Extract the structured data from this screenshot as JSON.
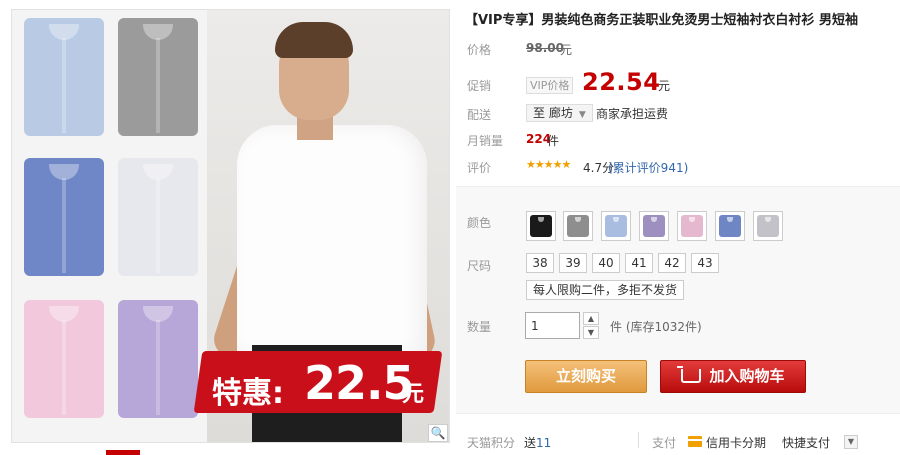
{
  "product": {
    "title": "【VIP专享】男装纯色商务正装职业免烫男士短袖衬衣白衬衫 男短袖"
  },
  "image": {
    "promo_label": "特惠:",
    "promo_price": "22.5",
    "promo_unit": "元",
    "thumbnail_colors": [
      "#b9cbe4",
      "#9b9b9b",
      "#6f87c6",
      "#e7e7ee",
      "#f1c8dc",
      "#b7a6d8"
    ]
  },
  "price": {
    "label": "价格",
    "original": "98.00",
    "original_unit": "元"
  },
  "promo": {
    "label": "促销",
    "tag": "VIP价格",
    "price": "22.54",
    "unit": "元"
  },
  "shipping": {
    "label": "配送",
    "destination": "至 廊坊",
    "note": "商家承担运费"
  },
  "sales": {
    "label": "月销量",
    "count": "224",
    "unit": "件"
  },
  "rating": {
    "label": "评价",
    "stars": "★★★★★",
    "score": "4.7分",
    "reviews": "(累计评价941)"
  },
  "sku": {
    "color_label": "颜色",
    "colors": [
      "#1a1a1a",
      "#8e8e8e",
      "#a9bde0",
      "#9d8fbf",
      "#e6b8cf",
      "#6f86c4",
      "#c2c2c8"
    ],
    "size_label": "尺码",
    "sizes": [
      "38",
      "39",
      "40",
      "41",
      "42",
      "43"
    ],
    "size_note": "每人限购二件，多拒不发货",
    "qty_label": "数量",
    "qty_value": "1",
    "qty_unit": "件 (库存1032件)"
  },
  "actions": {
    "buy_now": "立刻购买",
    "add_to_cart": "加入购物车"
  },
  "footer": {
    "points_label": "天猫积分",
    "points_prefix": "送",
    "points_value": "11",
    "pay_label": "支付",
    "credit_card": "信用卡分期",
    "quick_pay": "快捷支付"
  }
}
